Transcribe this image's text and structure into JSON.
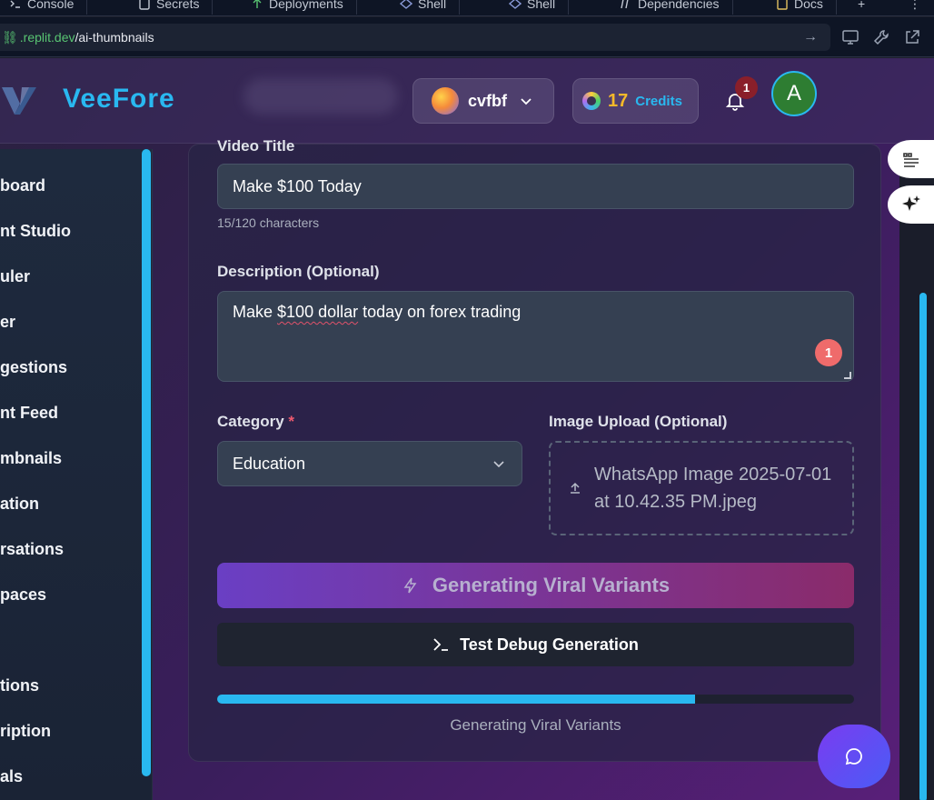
{
  "tabs": [
    {
      "label": "Console",
      "icon": "terminal-icon"
    },
    {
      "label": "Secrets",
      "icon": "lock-icon"
    },
    {
      "label": "Deployments",
      "icon": "rocket-icon"
    },
    {
      "label": "Shell",
      "icon": "shell-icon"
    },
    {
      "label": "Shell",
      "icon": "shell-icon"
    },
    {
      "label": "Dependencies",
      "icon": "package-icon"
    },
    {
      "label": "Docs",
      "icon": "book-icon"
    }
  ],
  "url": {
    "domain": ".replit.dev",
    "path": "/ai-thumbnails"
  },
  "header": {
    "brand": "VeeFore",
    "workspace": "cvfbf",
    "credits_count": "17",
    "credits_label": "Credits",
    "notifications_count": "1",
    "avatar_initial": "A"
  },
  "sidebar": {
    "items": [
      "board",
      "nt Studio",
      "uler",
      "er",
      "gestions",
      "nt Feed",
      "mbnails",
      "ation",
      "rsations",
      "paces",
      "tions",
      "ription",
      "als"
    ]
  },
  "form": {
    "title_label": "Video Title",
    "title_value": "Make $100 Today",
    "title_counter": "15/120 characters",
    "description_label": "Description (Optional)",
    "description_pre": "Make ",
    "description_spell": "$100 dollar",
    "description_post": " today on forex trading",
    "description_badge": "1",
    "category_label": "Category",
    "category_required": "*",
    "category_value": "Education",
    "upload_label": "Image Upload (Optional)",
    "upload_file": "WhatsApp Image 2025-07-01 at 10.42.35 PM.jpeg",
    "generate_label": "Generating Viral Variants",
    "debug_label": "Test Debug Generation",
    "progress_label": "Generating Viral Variants",
    "progress_fraction": 0.75
  },
  "colors": {
    "accent": "#29b8f0",
    "credits": "#f5b92a",
    "required": "#ef5a6f"
  }
}
